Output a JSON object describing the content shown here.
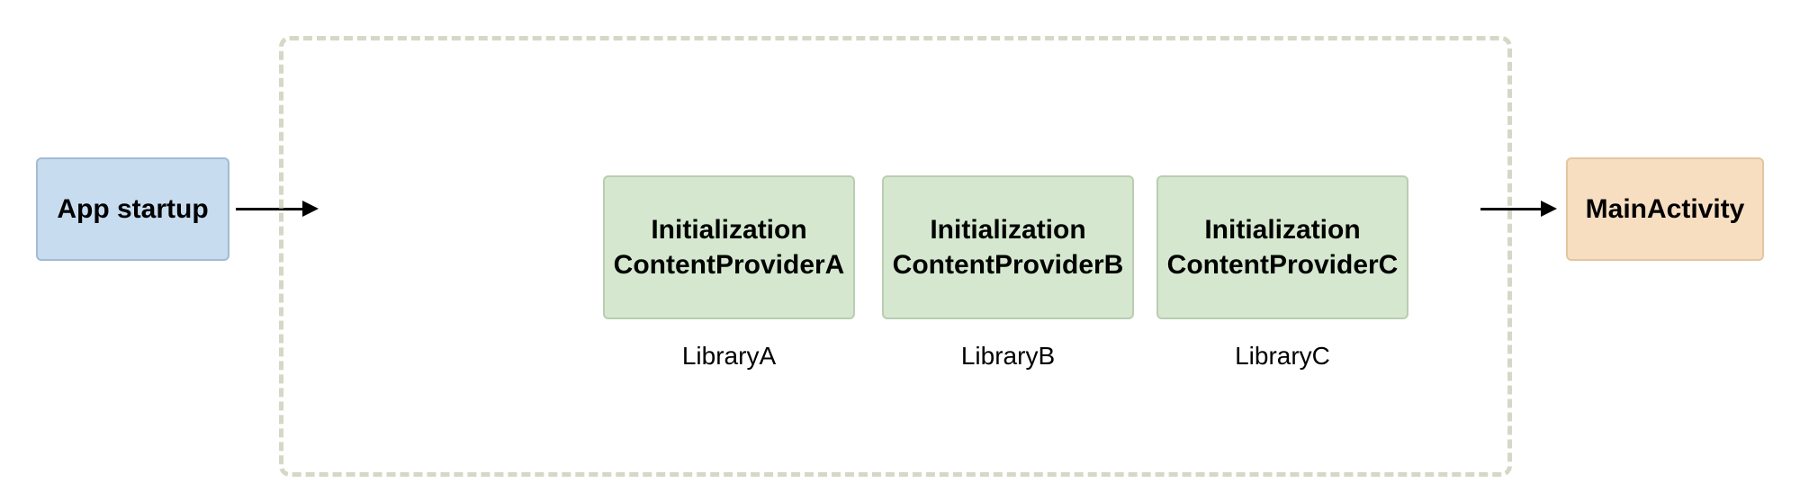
{
  "boxes": {
    "app_startup": "App startup",
    "main_activity": "MainActivity",
    "providerA_line1": "Initialization",
    "providerA_line2": "ContentProviderA",
    "providerB_line1": "Initialization",
    "providerB_line2": "ContentProviderB",
    "providerC_line1": "Initialization",
    "providerC_line2": "ContentProviderC"
  },
  "captions": {
    "libA": "LibraryA",
    "libB": "LibraryB",
    "libC": "LibraryC"
  },
  "colors": {
    "startup_bg": "#c8dcf0",
    "provider_bg": "#d5e8cf",
    "main_bg": "#f8dec1",
    "dash": "#d5d8c6"
  }
}
